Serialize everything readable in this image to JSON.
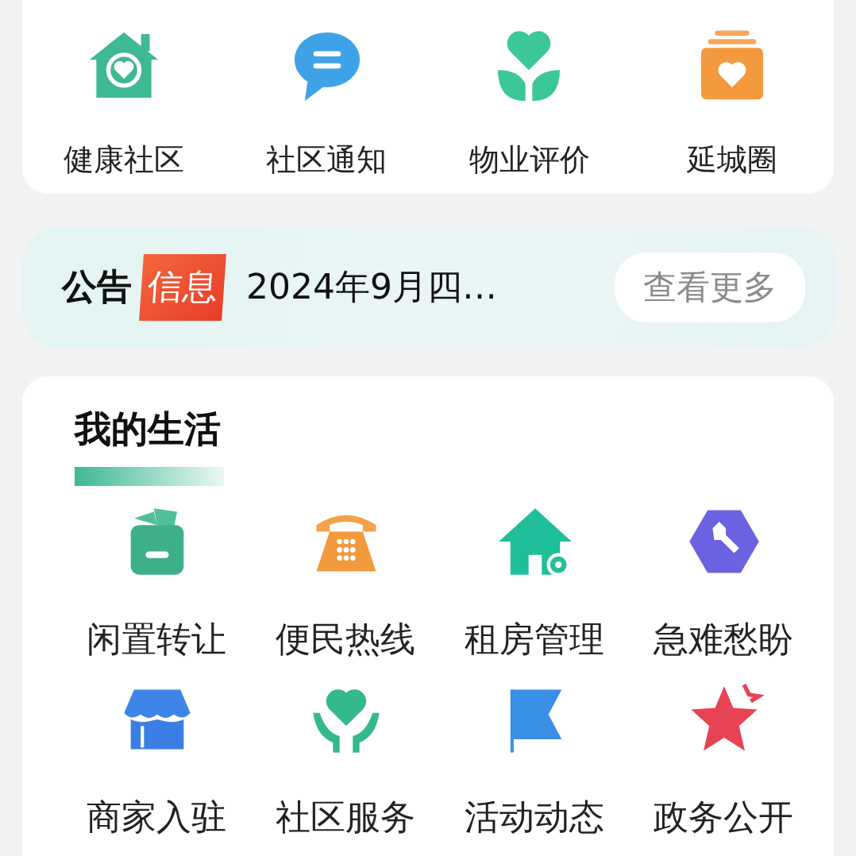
{
  "top_shortcuts": [
    {
      "label": "健康社区"
    },
    {
      "label": "社区通知"
    },
    {
      "label": "物业评价"
    },
    {
      "label": "延城圈"
    }
  ],
  "notice": {
    "title": "公告",
    "badge": "信息",
    "text": "2024年9月四…",
    "more_button": "查看更多"
  },
  "my_life": {
    "title": "我的生活",
    "items": [
      {
        "label": "闲置转让"
      },
      {
        "label": "便民热线"
      },
      {
        "label": "租房管理"
      },
      {
        "label": "急难愁盼"
      },
      {
        "label": "商家入驻"
      },
      {
        "label": "社区服务"
      },
      {
        "label": "活动动态"
      },
      {
        "label": "政务公开"
      }
    ]
  }
}
